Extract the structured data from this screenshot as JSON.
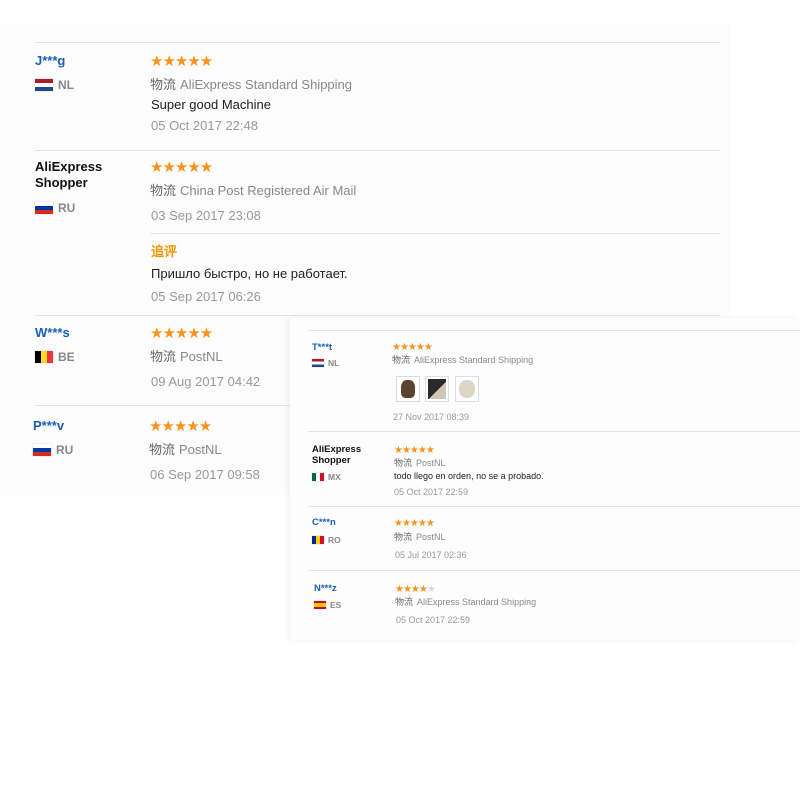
{
  "left_reviews": [
    {
      "user": "J***g",
      "country": "NL",
      "stars": "★★★★★",
      "shipping_prefix": "物流",
      "shipping": "AliExpress Standard Shipping",
      "feedback": "Super good Machine",
      "date": "05 Oct 2017 22:48"
    },
    {
      "user_line1": "AliExpress",
      "user_line2": "Shopper",
      "country": "RU",
      "stars": "★★★★★",
      "shipping_prefix": "物流",
      "shipping": "China Post Registered Air Mail",
      "date": "03 Sep 2017 23:08",
      "additional_label": "追评",
      "additional_feedback": "Пришло быстро, но не работает.",
      "additional_date": "05 Sep 2017 06:26"
    },
    {
      "user": "W***s",
      "country": "BE",
      "stars": "★★★★★",
      "shipping_prefix": "物流",
      "shipping": "PostNL",
      "date": "09 Aug 2017 04:42"
    },
    {
      "user": "P***v",
      "country": "RU",
      "stars": "★★★★★",
      "shipping_prefix": "物流",
      "shipping": "PostNL",
      "date": "06 Sep 2017 09:58"
    }
  ],
  "right_reviews": [
    {
      "user": "T***t",
      "country": "NL",
      "stars": "★★★★★",
      "shipping_prefix": "物流",
      "shipping": "AliExpress Standard Shipping",
      "date": "27 Nov 2017 08:39"
    },
    {
      "user_line1": "AliExpress",
      "user_line2": "Shopper",
      "country": "MX",
      "stars": "★★★★★",
      "shipping_prefix": "物流",
      "shipping": "PostNL",
      "feedback": "todo llego en orden, no se a probado.",
      "date": "05 Oct 2017 22:59"
    },
    {
      "user": "C***n",
      "country": "RO",
      "stars": "★★★★★",
      "shipping_prefix": "物流",
      "shipping": "PostNL",
      "date": "05 Jul 2017 02:36"
    },
    {
      "user": "N***z",
      "country": "ES",
      "stars_on": "★★★★",
      "stars_off": "★",
      "shipping_prefix": "物流",
      "shipping": "AliExpress Standard Shipping",
      "date": "05 Oct 2017 22:59"
    }
  ],
  "colors": {
    "link": "#1a5fb4",
    "star": "#f7931e",
    "additional": "#f39800"
  }
}
